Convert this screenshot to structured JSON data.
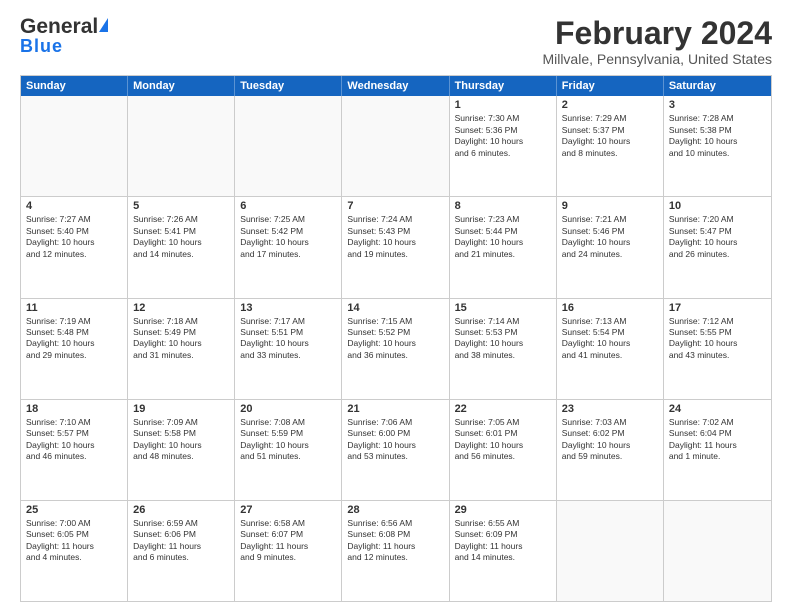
{
  "header": {
    "logo_general": "General",
    "logo_blue": "Blue",
    "title": "February 2024",
    "subtitle": "Millvale, Pennsylvania, United States"
  },
  "calendar": {
    "days_of_week": [
      "Sunday",
      "Monday",
      "Tuesday",
      "Wednesday",
      "Thursday",
      "Friday",
      "Saturday"
    ],
    "rows": [
      [
        {
          "day": "",
          "content": ""
        },
        {
          "day": "",
          "content": ""
        },
        {
          "day": "",
          "content": ""
        },
        {
          "day": "",
          "content": ""
        },
        {
          "day": "1",
          "content": "Sunrise: 7:30 AM\nSunset: 5:36 PM\nDaylight: 10 hours\nand 6 minutes."
        },
        {
          "day": "2",
          "content": "Sunrise: 7:29 AM\nSunset: 5:37 PM\nDaylight: 10 hours\nand 8 minutes."
        },
        {
          "day": "3",
          "content": "Sunrise: 7:28 AM\nSunset: 5:38 PM\nDaylight: 10 hours\nand 10 minutes."
        }
      ],
      [
        {
          "day": "4",
          "content": "Sunrise: 7:27 AM\nSunset: 5:40 PM\nDaylight: 10 hours\nand 12 minutes."
        },
        {
          "day": "5",
          "content": "Sunrise: 7:26 AM\nSunset: 5:41 PM\nDaylight: 10 hours\nand 14 minutes."
        },
        {
          "day": "6",
          "content": "Sunrise: 7:25 AM\nSunset: 5:42 PM\nDaylight: 10 hours\nand 17 minutes."
        },
        {
          "day": "7",
          "content": "Sunrise: 7:24 AM\nSunset: 5:43 PM\nDaylight: 10 hours\nand 19 minutes."
        },
        {
          "day": "8",
          "content": "Sunrise: 7:23 AM\nSunset: 5:44 PM\nDaylight: 10 hours\nand 21 minutes."
        },
        {
          "day": "9",
          "content": "Sunrise: 7:21 AM\nSunset: 5:46 PM\nDaylight: 10 hours\nand 24 minutes."
        },
        {
          "day": "10",
          "content": "Sunrise: 7:20 AM\nSunset: 5:47 PM\nDaylight: 10 hours\nand 26 minutes."
        }
      ],
      [
        {
          "day": "11",
          "content": "Sunrise: 7:19 AM\nSunset: 5:48 PM\nDaylight: 10 hours\nand 29 minutes."
        },
        {
          "day": "12",
          "content": "Sunrise: 7:18 AM\nSunset: 5:49 PM\nDaylight: 10 hours\nand 31 minutes."
        },
        {
          "day": "13",
          "content": "Sunrise: 7:17 AM\nSunset: 5:51 PM\nDaylight: 10 hours\nand 33 minutes."
        },
        {
          "day": "14",
          "content": "Sunrise: 7:15 AM\nSunset: 5:52 PM\nDaylight: 10 hours\nand 36 minutes."
        },
        {
          "day": "15",
          "content": "Sunrise: 7:14 AM\nSunset: 5:53 PM\nDaylight: 10 hours\nand 38 minutes."
        },
        {
          "day": "16",
          "content": "Sunrise: 7:13 AM\nSunset: 5:54 PM\nDaylight: 10 hours\nand 41 minutes."
        },
        {
          "day": "17",
          "content": "Sunrise: 7:12 AM\nSunset: 5:55 PM\nDaylight: 10 hours\nand 43 minutes."
        }
      ],
      [
        {
          "day": "18",
          "content": "Sunrise: 7:10 AM\nSunset: 5:57 PM\nDaylight: 10 hours\nand 46 minutes."
        },
        {
          "day": "19",
          "content": "Sunrise: 7:09 AM\nSunset: 5:58 PM\nDaylight: 10 hours\nand 48 minutes."
        },
        {
          "day": "20",
          "content": "Sunrise: 7:08 AM\nSunset: 5:59 PM\nDaylight: 10 hours\nand 51 minutes."
        },
        {
          "day": "21",
          "content": "Sunrise: 7:06 AM\nSunset: 6:00 PM\nDaylight: 10 hours\nand 53 minutes."
        },
        {
          "day": "22",
          "content": "Sunrise: 7:05 AM\nSunset: 6:01 PM\nDaylight: 10 hours\nand 56 minutes."
        },
        {
          "day": "23",
          "content": "Sunrise: 7:03 AM\nSunset: 6:02 PM\nDaylight: 10 hours\nand 59 minutes."
        },
        {
          "day": "24",
          "content": "Sunrise: 7:02 AM\nSunset: 6:04 PM\nDaylight: 11 hours\nand 1 minute."
        }
      ],
      [
        {
          "day": "25",
          "content": "Sunrise: 7:00 AM\nSunset: 6:05 PM\nDaylight: 11 hours\nand 4 minutes."
        },
        {
          "day": "26",
          "content": "Sunrise: 6:59 AM\nSunset: 6:06 PM\nDaylight: 11 hours\nand 6 minutes."
        },
        {
          "day": "27",
          "content": "Sunrise: 6:58 AM\nSunset: 6:07 PM\nDaylight: 11 hours\nand 9 minutes."
        },
        {
          "day": "28",
          "content": "Sunrise: 6:56 AM\nSunset: 6:08 PM\nDaylight: 11 hours\nand 12 minutes."
        },
        {
          "day": "29",
          "content": "Sunrise: 6:55 AM\nSunset: 6:09 PM\nDaylight: 11 hours\nand 14 minutes."
        },
        {
          "day": "",
          "content": ""
        },
        {
          "day": "",
          "content": ""
        }
      ]
    ]
  }
}
